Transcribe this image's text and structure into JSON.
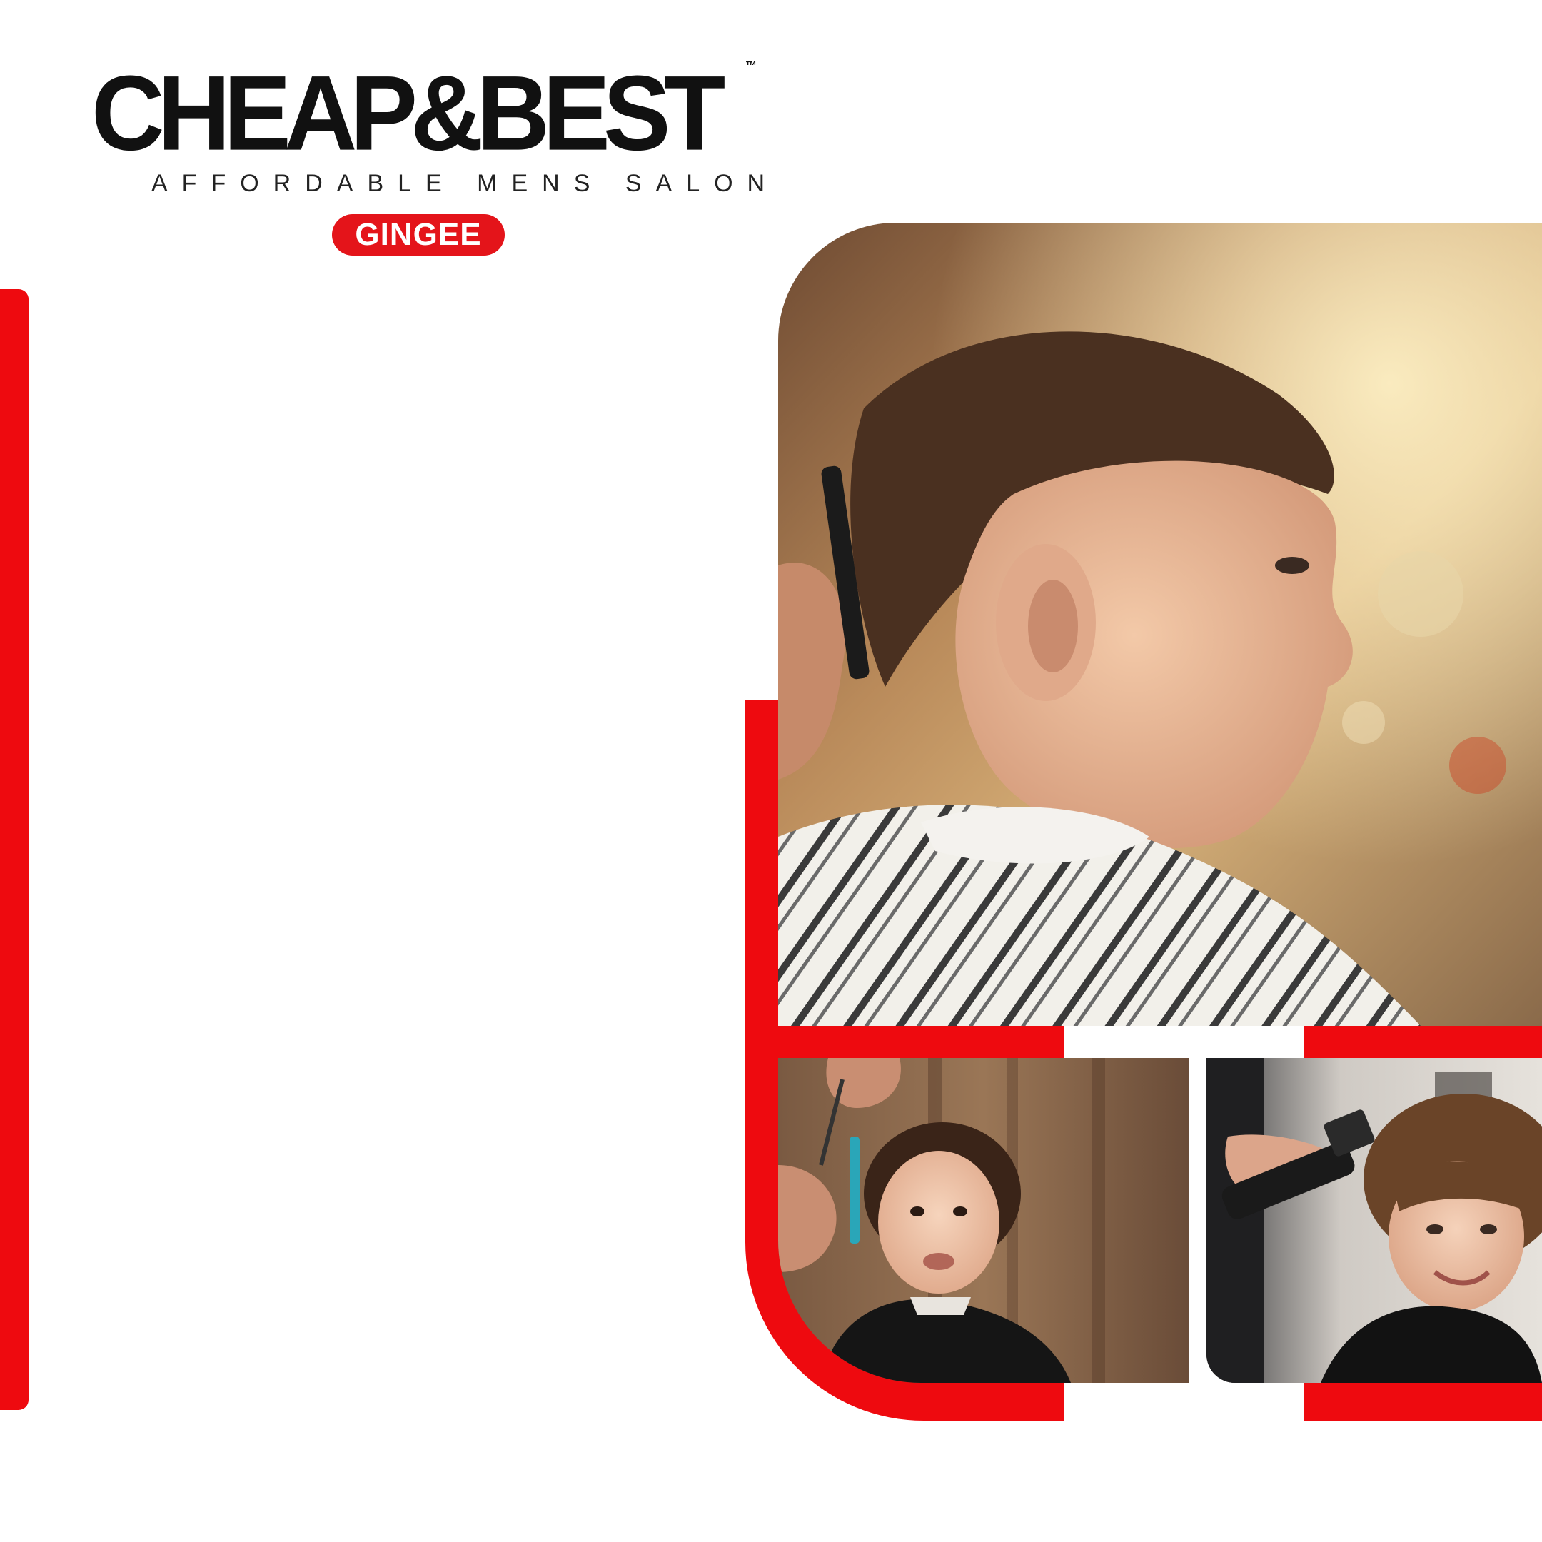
{
  "brand": {
    "name": "CHEAP&BEST",
    "trademark": "™",
    "tagline": "AFFORDABLE MENS SALON",
    "location": "GINGEE"
  },
  "colors": {
    "accent_red": "#ee0a0f",
    "badge_red": "#e4141a",
    "logo_text": "#111111",
    "background": "#ffffff"
  },
  "images": {
    "main": "boy-haircut-side-profile",
    "bottom_left": "toddler-haircut-with-comb-and-scissors",
    "bottom_right": "smiling-boy-haircut-with-clipper"
  }
}
